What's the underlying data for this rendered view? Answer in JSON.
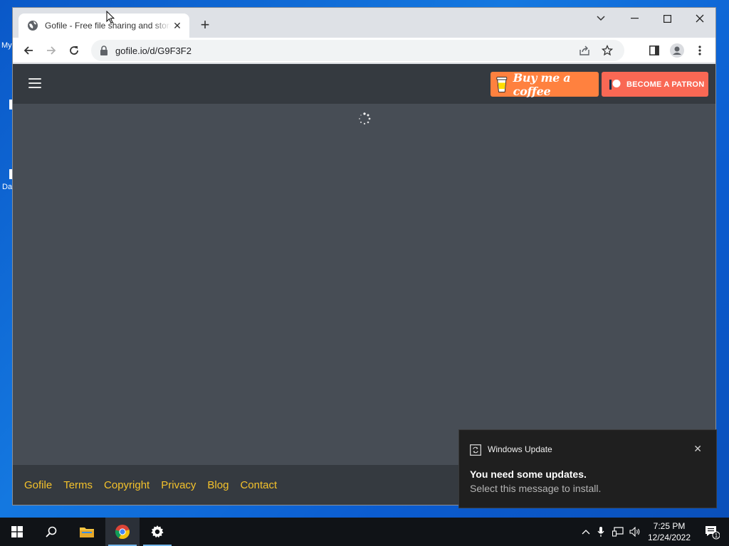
{
  "desktop": {
    "fragments": [
      "My",
      "Da"
    ]
  },
  "browser": {
    "tab_title": "Gofile - Free file sharing and storage",
    "url": "gofile.io/d/G9F3F2"
  },
  "site": {
    "buy_coffee_label": "Buy me a coffee",
    "patron_label": "BECOME A PATRON",
    "footer_links": [
      "Gofile",
      "Terms",
      "Copyright",
      "Privacy",
      "Blog",
      "Contact"
    ]
  },
  "toast": {
    "app_name": "Windows Update",
    "title": "You need some updates.",
    "body": "Select this message to install."
  },
  "taskbar": {
    "time": "7:25 PM",
    "date": "12/24/2022",
    "notification_count": "1"
  },
  "colors": {
    "accent_footer_link": "#f4c22b",
    "bmc_orange": "#ff813f",
    "patreon_red": "#f96854",
    "page_bg": "#474d55",
    "header_bg": "#353a40"
  }
}
